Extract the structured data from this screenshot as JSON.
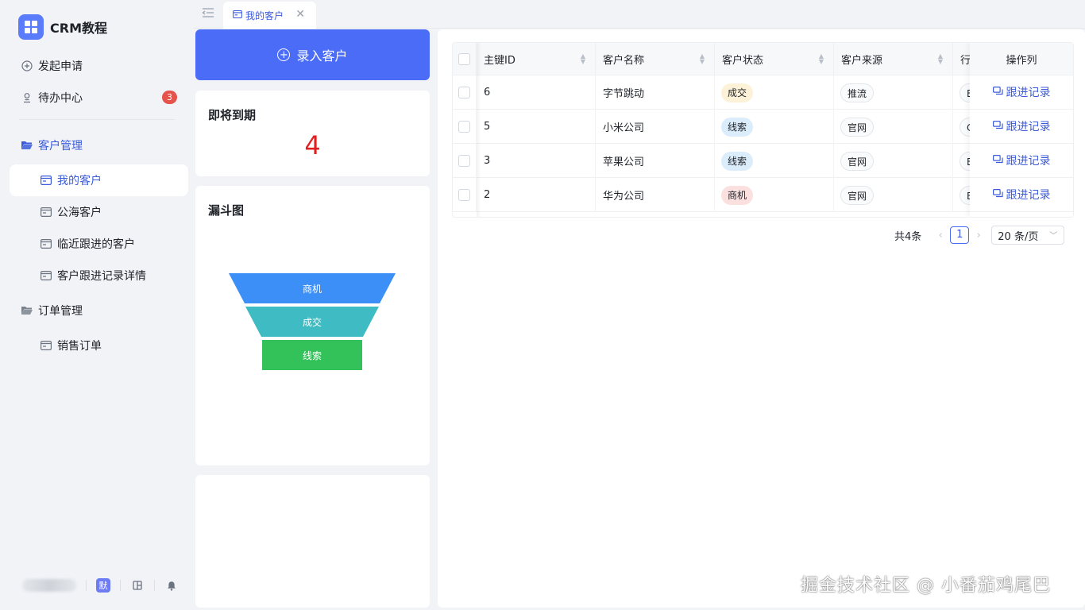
{
  "brand": {
    "name": "CRM教程",
    "icon": "windows-grid-icon"
  },
  "sidebar": {
    "items": [
      {
        "label": "发起申请",
        "icon": "plus-circle-icon"
      },
      {
        "label": "待办中心",
        "icon": "user-stamp-icon",
        "badge": "3"
      }
    ],
    "groups": [
      {
        "label": "客户管理",
        "icon": "folder-open-icon",
        "children": [
          {
            "label": "我的客户",
            "icon": "card-icon",
            "active": true
          },
          {
            "label": "公海客户",
            "icon": "card-icon"
          },
          {
            "label": "临近跟进的客户",
            "icon": "card-icon"
          },
          {
            "label": "客户跟进记录详情",
            "icon": "card-icon"
          }
        ]
      },
      {
        "label": "订单管理",
        "icon": "folder-icon",
        "children": [
          {
            "label": "销售订单",
            "icon": "card-icon"
          }
        ]
      }
    ],
    "footer": {
      "lang_badge": "默",
      "lang_color": "#6d7cf5"
    }
  },
  "tabs": [
    {
      "label": "我的客户",
      "active": true
    }
  ],
  "add_button": {
    "label": "录入客户"
  },
  "due_card": {
    "title": "即将到期",
    "count": "4",
    "count_color": "#e02020"
  },
  "funnel_card": {
    "title": "漏斗图",
    "stages": [
      {
        "label": "商机",
        "color": "#3b8ff7"
      },
      {
        "label": "成交",
        "color": "#3fbcc3"
      },
      {
        "label": "线索",
        "color": "#33c15a"
      }
    ]
  },
  "table": {
    "columns": [
      "主键ID",
      "客户名称",
      "客户状态",
      "客户来源",
      "行业",
      "操作列"
    ],
    "rows": [
      {
        "id": "6",
        "name": "字节跳动",
        "status": "成交",
        "status_bg": "#fdf1d8",
        "source": "推流",
        "industry": "E",
        "action": "跟进记录"
      },
      {
        "id": "5",
        "name": "小米公司",
        "status": "线索",
        "status_bg": "#dbecfb",
        "source": "官网",
        "industry": "C",
        "action": "跟进记录"
      },
      {
        "id": "3",
        "name": "苹果公司",
        "status": "线索",
        "status_bg": "#dbecfb",
        "source": "官网",
        "industry": "E",
        "action": "跟进记录"
      },
      {
        "id": "2",
        "name": "华为公司",
        "status": "商机",
        "status_bg": "#fbe0e0",
        "source": "官网",
        "industry": "E",
        "action": "跟进记录"
      }
    ]
  },
  "pagination": {
    "total": "共4条",
    "current_page": "1",
    "page_size": "20 条/页"
  },
  "watermark": "掘金技术社区 @ 小番茄鸡尾巴",
  "colors": {
    "primary": "#4a6cf7",
    "active_text": "#3b5bdb",
    "badge": "#e5534b"
  }
}
